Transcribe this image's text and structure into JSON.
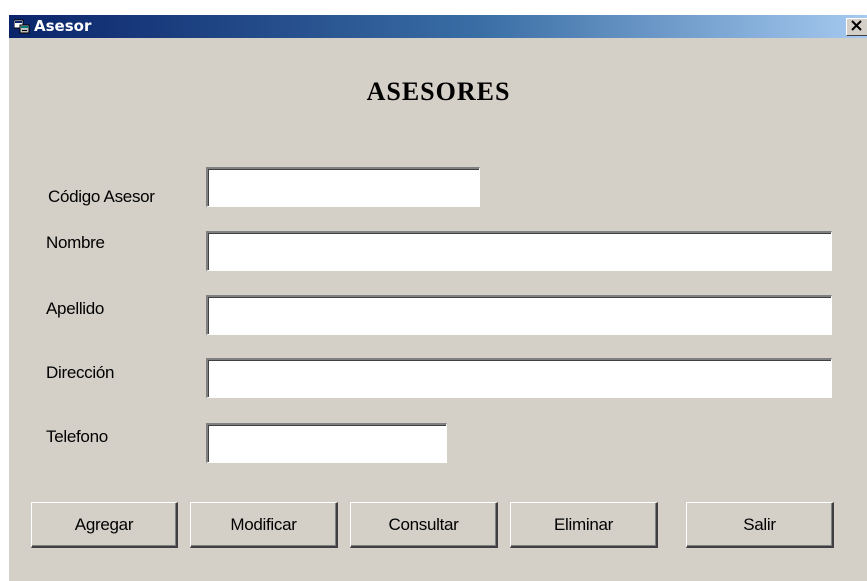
{
  "window": {
    "title": "Asesor",
    "icon": "form-window-icon",
    "close_icon": "close-x-icon",
    "titlebar_color_start": "#0a246a",
    "titlebar_color_end": "#a6caf0",
    "background_color": "#d4d0c8"
  },
  "form": {
    "heading": "ASESORES",
    "fields": {
      "codigo": {
        "label": "Código Asesor",
        "value": ""
      },
      "nombre": {
        "label": "Nombre",
        "value": ""
      },
      "apellido": {
        "label": "Apellido",
        "value": ""
      },
      "direccion": {
        "label": "Dirección",
        "value": ""
      },
      "telefono": {
        "label": "Telefono",
        "value": ""
      }
    }
  },
  "buttons": {
    "agregar": "Agregar",
    "modificar": "Modificar",
    "consultar": "Consultar",
    "eliminar": "Eliminar",
    "salir": "Salir"
  }
}
